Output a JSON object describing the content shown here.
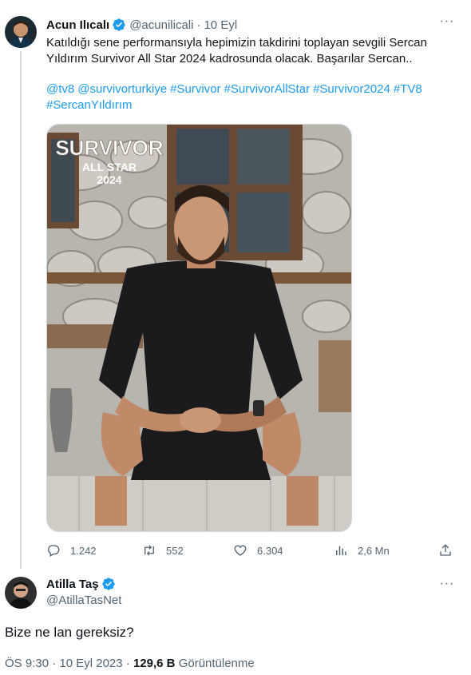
{
  "main_tweet": {
    "author_name": "Acun Ilıcalı",
    "handle": "@acunilicali",
    "separator": "·",
    "date": "10 Eyl",
    "more": "···",
    "text_line1": "Katıldığı sene performansıyla hepimizin takdirini toplayan sevgili Sercan",
    "text_line2": "Yıldırım Survivor All Star 2024 kadrosunda olacak. Başarılar Sercan..",
    "hashtags": [
      "@tv8",
      "@survivorturkiye",
      "#Survivor",
      "#SurvivorAllStar",
      "#Survivor2024",
      "#TV8",
      "#SercanYıldırım"
    ],
    "media": {
      "logo_line1": "SURVIVOR",
      "logo_line2": "ALL STAR",
      "logo_line3": "2024"
    },
    "stats": {
      "replies": "1.242",
      "retweets": "552",
      "likes": "6.304",
      "views": "2,6 Mn"
    }
  },
  "reply_tweet": {
    "author_name": "Atilla Taş",
    "handle": "@AtillaTasNet",
    "more": "···",
    "text": "Bize ne lan gereksiz?",
    "time": "ÖS 9:30",
    "separator": "·",
    "date": "10 Eyl 2023",
    "views_count": "129,6 B",
    "views_label": "Görüntülenme"
  },
  "colors": {
    "link": "#1d9bf0",
    "verified": "#1d9bf0",
    "muted": "#536471",
    "text": "#0f1419"
  },
  "icons": [
    "verified-badge-icon",
    "more-icon",
    "reply-icon",
    "retweet-icon",
    "like-icon",
    "views-icon",
    "share-icon"
  ]
}
